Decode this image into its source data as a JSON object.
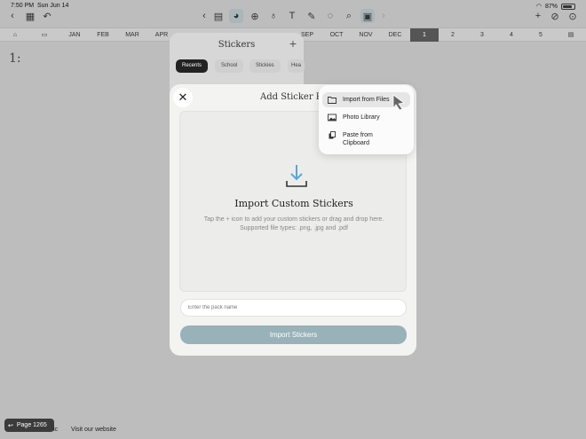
{
  "status": {
    "time": "7:50 PM",
    "date": "Sun Jun 14",
    "battery": "87%"
  },
  "months": [
    "JAN",
    "FEB",
    "MAR",
    "APR",
    "SEP",
    "OCT",
    "NOV",
    "DEC",
    "1",
    "2",
    "3",
    "4",
    "5"
  ],
  "page": {
    "number": "1:"
  },
  "stickers_panel": {
    "title": "Stickers",
    "tabs": [
      "Recents",
      "School",
      "Stickies",
      "Hea"
    ]
  },
  "modal": {
    "title": "Add Sticker Pack",
    "drop_title": "Import Custom Stickers",
    "drop_desc": "Tap the + icon to add your custom stickers or drag and drop here. Supported file types: .png, .jpg and .pdf",
    "input_placeholder": "Enter the pack name",
    "import_label": "Import Stickers"
  },
  "menu": {
    "items": [
      "Import from Files",
      "Photo Library",
      "Paste from Clipboard"
    ]
  },
  "bottom": {
    "page_label": "Page 1265",
    "text": "ic",
    "link": "Visit our website"
  },
  "colors": {
    "accent": "#99b1b8",
    "selected_month": "#555555"
  }
}
